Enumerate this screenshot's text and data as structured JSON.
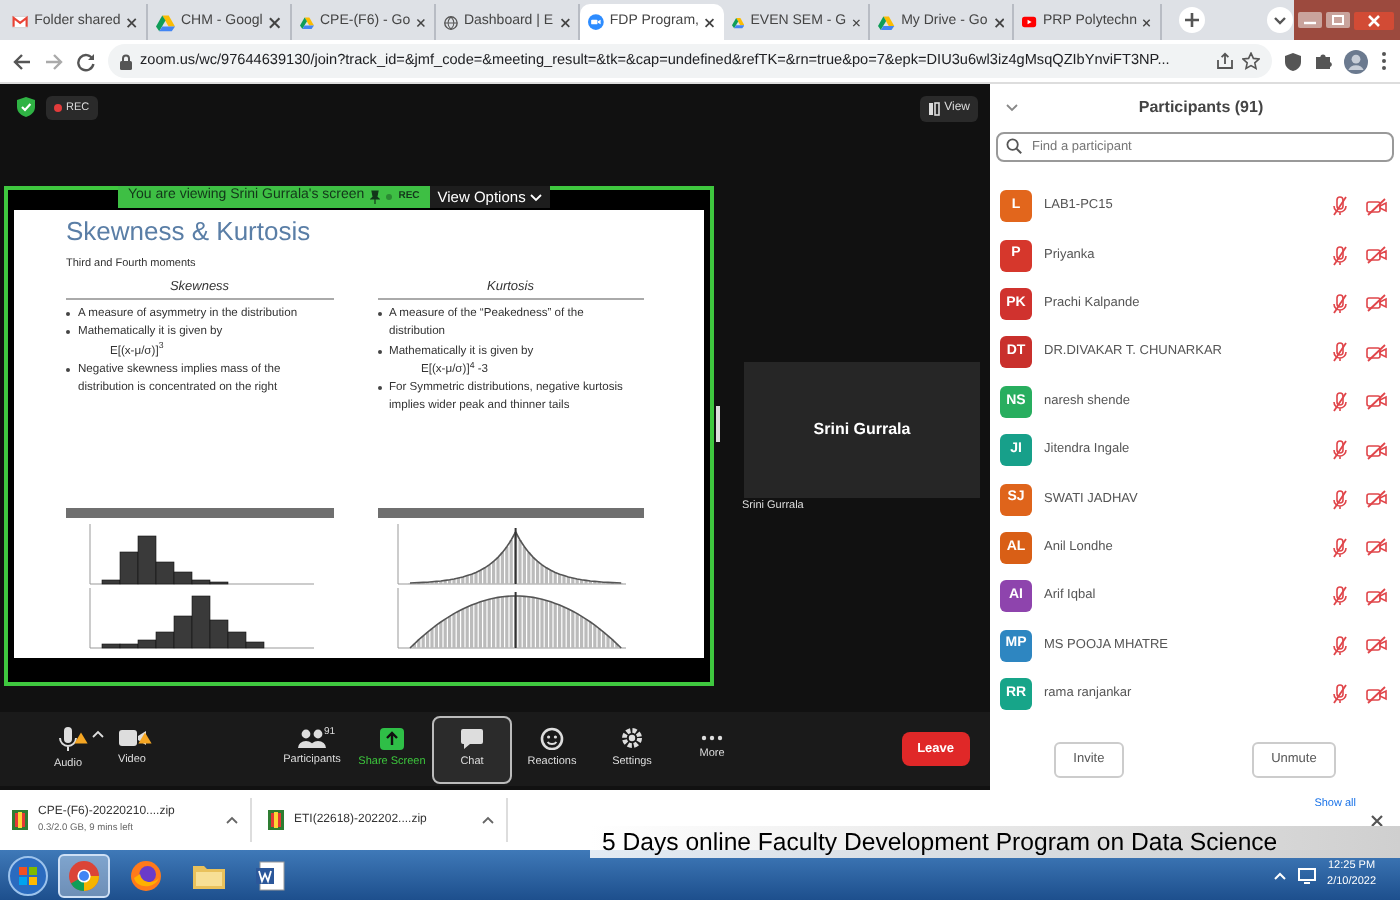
{
  "browser": {
    "tabs": [
      {
        "label": "Folder shared",
        "kind": "mail",
        "selected": false
      },
      {
        "label": "CHM - Googl",
        "kind": "drive",
        "selected": false
      },
      {
        "label": "CPE-(F6) - Go",
        "kind": "drive",
        "selected": false
      },
      {
        "label": "Dashboard | E",
        "kind": "globe",
        "selected": false
      },
      {
        "label": "FDP Program,",
        "kind": "zoom",
        "selected": true
      },
      {
        "label": "EVEN SEM - G",
        "kind": "drive",
        "selected": false
      },
      {
        "label": "My Drive - Go",
        "kind": "drive",
        "selected": false
      },
      {
        "label": "PRP Polytechn",
        "kind": "play",
        "selected": false
      }
    ],
    "url": "zoom.us/wc/97644639130/join?track_id=&jmf_code=&meeting_result=&tk=&cap=undefined&refTK=&rn=true&po=7&epk=DIU3u6wl3iz4gMsqQZIbYnviFT3NP..."
  },
  "meeting": {
    "rec_badge": "REC",
    "view_button": "View",
    "share_banner": {
      "text": "You are viewing Srini Gurrala's screen",
      "rec": "REC",
      "view_options": "View Options"
    },
    "slide": {
      "title": "Skewness & Kurtosis",
      "subtitle": "Third and Fourth moments",
      "columns": [
        {
          "heading": "Skewness",
          "kind": "skew",
          "bullets": [
            {
              "kind": "bullet",
              "text": "A measure of asymmetry in the distribution"
            },
            {
              "kind": "bullet",
              "text": "Mathematically it is given by"
            },
            {
              "kind": "formula",
              "text": "E[(x-μ/σ)]$^{3}$"
            },
            {
              "kind": "bullet",
              "text": "Negative skewness implies mass of the distribution is concentrated on the right"
            }
          ]
        },
        {
          "heading": "Kurtosis",
          "kind": "kurt",
          "bullets": [
            {
              "kind": "bullet",
              "text": "A measure of the “Peakedness” of the distribution"
            },
            {
              "kind": "bullet",
              "text": "Mathematically it is given by"
            },
            {
              "kind": "formula",
              "text": "E[(x-μ/σ)]$^{4}$ -3"
            },
            {
              "kind": "bullet",
              "text": "For Symmetric  distributions, negative kurtosis implies wider peak and thinner tails"
            }
          ]
        }
      ]
    },
    "speaker": {
      "name": "Srini Gurrala",
      "label": "Srini Gurrala"
    },
    "toolbar": {
      "items": [
        {
          "kind": "audio",
          "label": "Audio",
          "warning": true,
          "selected": false
        },
        {
          "kind": "video",
          "label": "Video",
          "warning": true,
          "selected": false
        },
        {
          "kind": "participants",
          "label": "Participants",
          "count": "91",
          "warning": false,
          "selected": false
        },
        {
          "kind": "share",
          "label": "Share Screen",
          "warning": false,
          "selected": false
        },
        {
          "kind": "chat",
          "label": "Chat",
          "warning": false,
          "selected": true
        },
        {
          "kind": "reactions",
          "label": "Reactions",
          "warning": false,
          "selected": false
        },
        {
          "kind": "settings",
          "label": "Settings",
          "warning": false,
          "selected": false
        },
        {
          "kind": "more",
          "label": "More",
          "warning": false,
          "selected": false
        }
      ],
      "leave": "Leave"
    }
  },
  "participants_panel": {
    "title": "Participants (91)",
    "search": {
      "placeholder": "Find a participant"
    },
    "participants": [
      {
        "initials": "L",
        "name": "LAB1-PC15",
        "color": "#e2661c",
        "muted": true,
        "video_off": true
      },
      {
        "initials": "P",
        "name": "Priyanka",
        "color": "#d6372c",
        "muted": true,
        "video_off": true
      },
      {
        "initials": "PK",
        "name": "Prachi Kalpande",
        "color": "#d0322e",
        "muted": true,
        "video_off": true
      },
      {
        "initials": "DT",
        "name": "DR.DIVAKAR T. CHUNARKAR",
        "color": "#c9302c",
        "muted": true,
        "video_off": true
      },
      {
        "initials": "NS",
        "name": "naresh shende",
        "color": "#28ae5f",
        "muted": true,
        "video_off": true
      },
      {
        "initials": "JI",
        "name": "Jitendra Ingale",
        "color": "#17a08a",
        "muted": true,
        "video_off": true
      },
      {
        "initials": "SJ",
        "name": "SWATI JADHAV",
        "color": "#df641b",
        "muted": true,
        "video_off": true
      },
      {
        "initials": "AL",
        "name": "Anil Londhe",
        "color": "#d95f16",
        "muted": true,
        "video_off": true
      },
      {
        "initials": "AI",
        "name": "Arif Iqbal",
        "color": "#8e44ad",
        "muted": true,
        "video_off": true
      },
      {
        "initials": "MP",
        "name": "MS POOJA MHATRE",
        "color": "#2e86c1",
        "muted": true,
        "video_off": true
      },
      {
        "initials": "RR",
        "name": "rama ranjankar",
        "color": "#17a589",
        "muted": true,
        "video_off": true
      }
    ],
    "buttons": [
      "Invite",
      "Unmute"
    ]
  },
  "downloads": {
    "items": [
      {
        "name": "CPE-(F6)-20220210....zip",
        "status": "0.3/2.0 GB, 9 mins left"
      },
      {
        "name": "ETI(22618)-202202....zip"
      }
    ],
    "show_all": "Show all"
  },
  "taskbar": {
    "apps": [
      {
        "kind": "chrome",
        "selected": true
      },
      {
        "kind": "firefox",
        "selected": false
      },
      {
        "kind": "folder",
        "selected": false
      },
      {
        "kind": "word",
        "selected": false
      }
    ],
    "time": "12:25 PM",
    "date": "2/10/2022"
  },
  "caption": "5 Days online Faculty Development Program on Data Science"
}
